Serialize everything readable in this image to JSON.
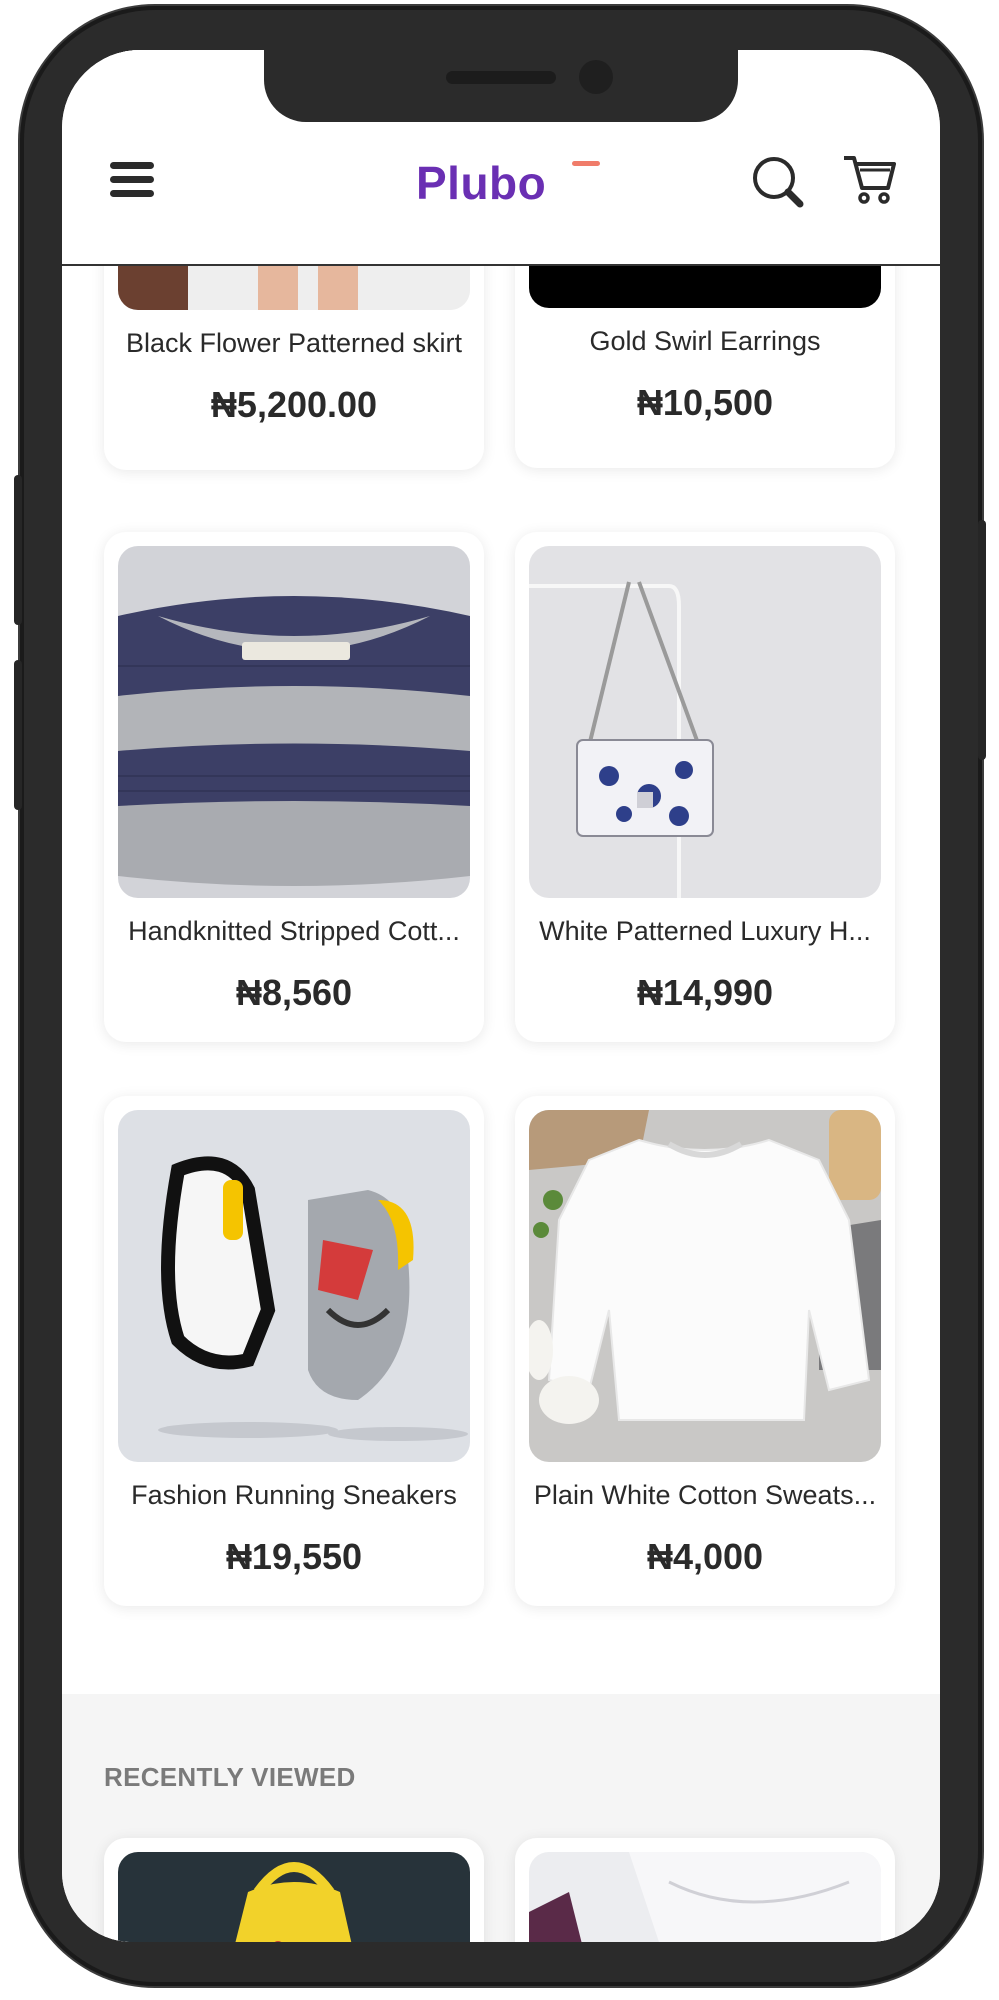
{
  "app": {
    "logo": "Plubo"
  },
  "header": {
    "menu_icon": "hamburger-menu-icon",
    "search_icon": "search-icon",
    "cart_icon": "shopping-cart-icon"
  },
  "products": [
    {
      "name": "Black Flower Patterned skirt",
      "price": "₦5,200.00"
    },
    {
      "name": "Gold Swirl Earrings",
      "price": "₦10,500"
    },
    {
      "name": "Handknitted Stripped Cott...",
      "price": "₦8,560"
    },
    {
      "name": "White Patterned Luxury H...",
      "price": "₦14,990"
    },
    {
      "name": "Fashion Running Sneakers",
      "price": "₦19,550"
    },
    {
      "name": "Plain White Cotton Sweats...",
      "price": "₦4,000"
    }
  ],
  "recently_viewed": {
    "title": "RECENTLY VIEWED"
  },
  "colors": {
    "brand": "#6a2fb3",
    "accent": "#f07c6a",
    "text": "#2a2a2a",
    "muted": "#7a7a7a"
  }
}
